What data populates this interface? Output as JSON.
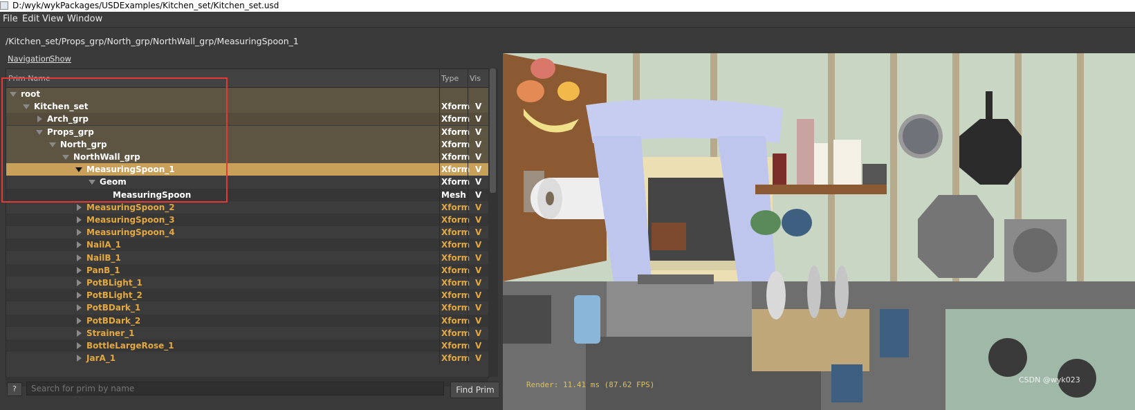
{
  "window": {
    "title": "D:/wyk/wykPackages/USDExamples/Kitchen_set/Kitchen_set.usd"
  },
  "menu": [
    "File",
    "Edit",
    "View",
    "Window"
  ],
  "path": "/Kitchen_set/Props_grp/North_grp/NorthWall_grp/MeasuringSpoon_1",
  "tabs": [
    "Navigation",
    "Show"
  ],
  "tree": {
    "columns": {
      "name": "Prim Name",
      "type": "Type",
      "vis": "Vis"
    },
    "rows": [
      {
        "name": "root",
        "type": "",
        "vis": "",
        "depth": 0,
        "arrow": "down",
        "style": "anc"
      },
      {
        "name": "Kitchen_set",
        "type": "Xform",
        "vis": "V",
        "depth": 1,
        "arrow": "down",
        "style": "anc"
      },
      {
        "name": "Arch_grp",
        "type": "Xform",
        "vis": "V",
        "depth": 2,
        "arrow": "right",
        "style": "anc alt"
      },
      {
        "name": "Props_grp",
        "type": "Xform",
        "vis": "V",
        "depth": 2,
        "arrow": "down",
        "style": "anc"
      },
      {
        "name": "North_grp",
        "type": "Xform",
        "vis": "V",
        "depth": 3,
        "arrow": "down",
        "style": "anc"
      },
      {
        "name": "NorthWall_grp",
        "type": "Xform",
        "vis": "V",
        "depth": 4,
        "arrow": "down",
        "style": "anc"
      },
      {
        "name": "MeasuringSpoon_1",
        "type": "Xform",
        "vis": "V",
        "depth": 5,
        "arrow": "down",
        "style": "sel"
      },
      {
        "name": "Geom",
        "type": "Xform",
        "vis": "V",
        "depth": 6,
        "arrow": "down",
        "style": "white"
      },
      {
        "name": "MeasuringSpoon",
        "type": "Mesh",
        "vis": "V",
        "depth": 7,
        "arrow": "none",
        "style": "white alt"
      },
      {
        "name": "MeasuringSpoon_2",
        "type": "Xform",
        "vis": "V",
        "depth": 5,
        "arrow": "right",
        "style": "norm"
      },
      {
        "name": "MeasuringSpoon_3",
        "type": "Xform",
        "vis": "V",
        "depth": 5,
        "arrow": "right",
        "style": "norm alt"
      },
      {
        "name": "MeasuringSpoon_4",
        "type": "Xform",
        "vis": "V",
        "depth": 5,
        "arrow": "right",
        "style": "norm"
      },
      {
        "name": "NailA_1",
        "type": "Xform",
        "vis": "V",
        "depth": 5,
        "arrow": "right",
        "style": "norm alt"
      },
      {
        "name": "NailB_1",
        "type": "Xform",
        "vis": "V",
        "depth": 5,
        "arrow": "right",
        "style": "norm"
      },
      {
        "name": "PanB_1",
        "type": "Xform",
        "vis": "V",
        "depth": 5,
        "arrow": "right",
        "style": "norm alt"
      },
      {
        "name": "PotBLight_1",
        "type": "Xform",
        "vis": "V",
        "depth": 5,
        "arrow": "right",
        "style": "norm"
      },
      {
        "name": "PotBLight_2",
        "type": "Xform",
        "vis": "V",
        "depth": 5,
        "arrow": "right",
        "style": "norm alt"
      },
      {
        "name": "PotBDark_1",
        "type": "Xform",
        "vis": "V",
        "depth": 5,
        "arrow": "right",
        "style": "norm"
      },
      {
        "name": "PotBDark_2",
        "type": "Xform",
        "vis": "V",
        "depth": 5,
        "arrow": "right",
        "style": "norm alt"
      },
      {
        "name": "Strainer_1",
        "type": "Xform",
        "vis": "V",
        "depth": 5,
        "arrow": "right",
        "style": "norm"
      },
      {
        "name": "BottleLargeRose_1",
        "type": "Xform",
        "vis": "V",
        "depth": 5,
        "arrow": "right",
        "style": "norm alt"
      },
      {
        "name": "JarA_1",
        "type": "Xform",
        "vis": "V",
        "depth": 5,
        "arrow": "right",
        "style": "norm"
      }
    ]
  },
  "search": {
    "placeholder": "Search for prim by name",
    "help": "?",
    "find_label": "Find Prim"
  },
  "viewport": {
    "render_stat": "Render: 11.41 ms (87.62 FPS)",
    "watermark": "CSDN @wyk023"
  },
  "colors": {
    "accent": "#e3a840",
    "selection": "#c9a05a",
    "ancestor_row": "#5e5442",
    "annotation_box": "#e53935"
  }
}
